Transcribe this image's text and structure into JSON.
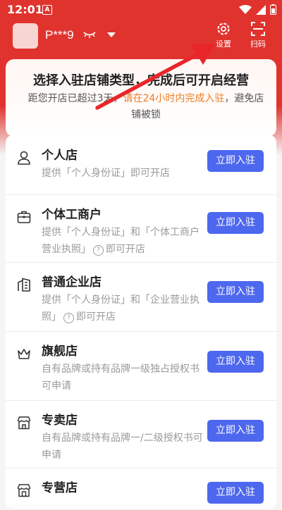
{
  "status_bar": {
    "time": "12:01",
    "notif": "A"
  },
  "header": {
    "username": "P***9",
    "settings_label": "设置",
    "scan_label": "扫码"
  },
  "banner": {
    "title": "选择入驻店铺类型，完成后可开启经营",
    "sub_prefix": "距您开店已超过3天，",
    "sub_highlight": "请在24小时内完成入驻",
    "sub_suffix": "，避免店铺被锁"
  },
  "stores": [
    {
      "title": "个人店",
      "desc_a": "提供「个人身份证」即可开店",
      "desc_b": "",
      "button": "立即入驻"
    },
    {
      "title": "个体工商户",
      "desc_a": "提供「个人身份证」和「个体工商户营业执照」",
      "desc_b": "即可开店",
      "button": "立即入驻"
    },
    {
      "title": "普通企业店",
      "desc_a": "提供「个人身份证」和「企业营业执照」",
      "desc_b": "即可开店",
      "button": "立即入驻"
    },
    {
      "title": "旗舰店",
      "desc_a": "自有品牌或持有品牌一级独占授权书可申请",
      "desc_b": "",
      "button": "立即入驻"
    },
    {
      "title": "专卖店",
      "desc_a": "自有品牌或持有品牌一/二级授权书可申请",
      "desc_b": "",
      "button": "立即入驻"
    },
    {
      "title": "专营店",
      "desc_a": "",
      "desc_b": "",
      "button": "立即入驻"
    }
  ],
  "colors": {
    "header_red": "#e0332e",
    "button_blue": "#4d67ee",
    "highlight_orange": "#ef7d25"
  }
}
